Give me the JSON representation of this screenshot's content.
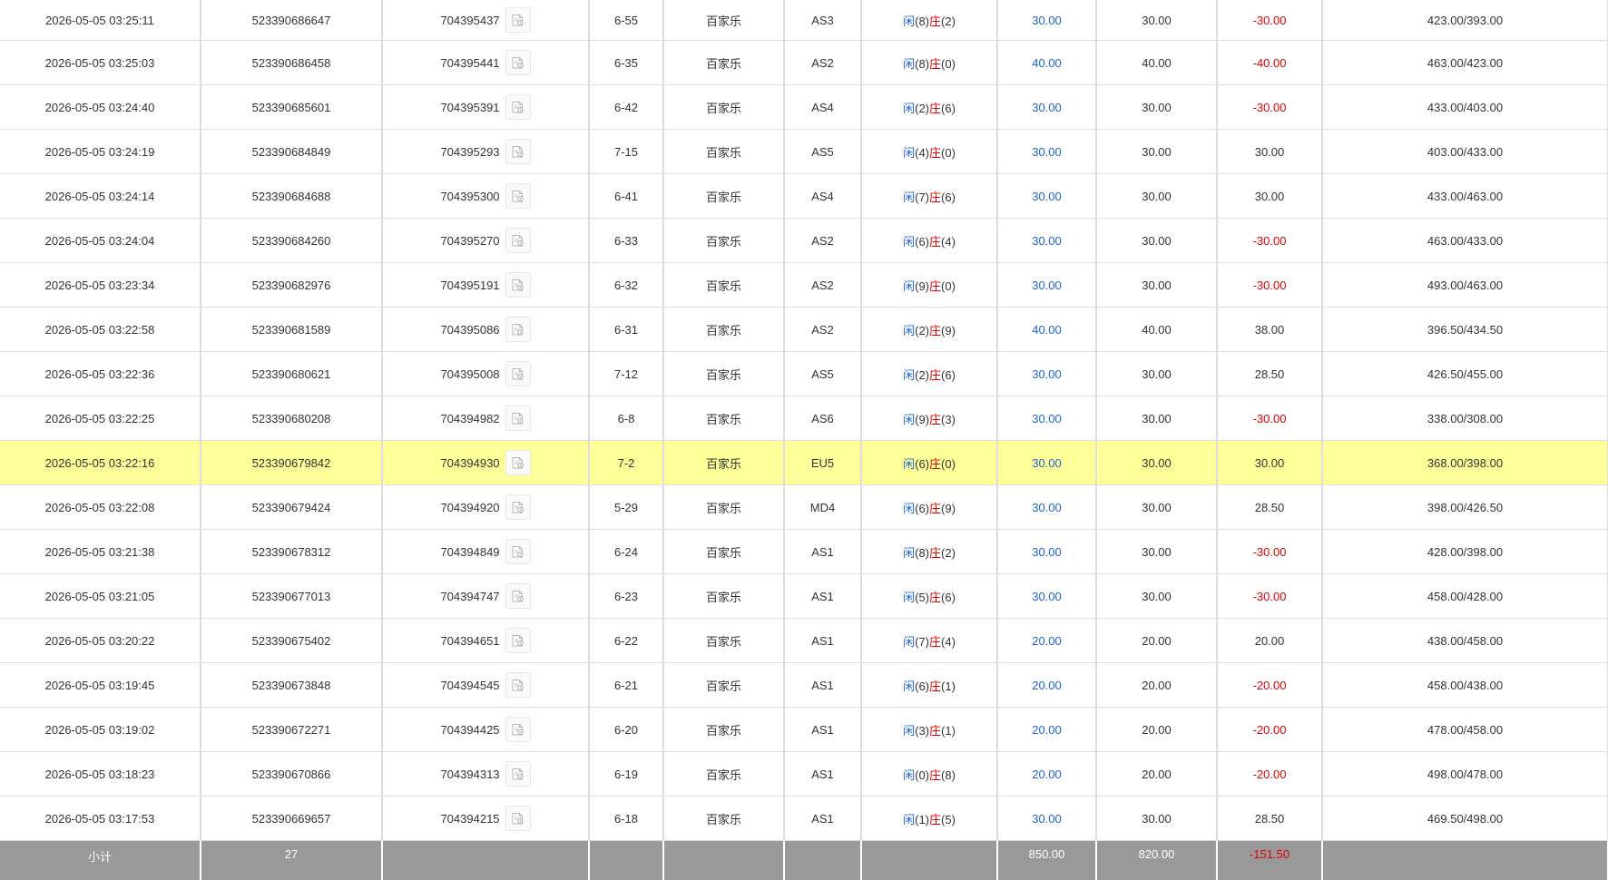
{
  "colors": {
    "win": "#1e64d6",
    "loss": "#e00000",
    "highlight": "#ffff99",
    "subtotal_bg": "#999999"
  },
  "icons": {
    "row_detail": "detail-document-icon"
  },
  "rows": [
    {
      "time": "2026-05-05 03:25:11",
      "bet_id": "523390686647",
      "game_id": "704395437",
      "round": "6-55",
      "game": "百家乐",
      "table": "AS3",
      "p_label": "闲",
      "p_score": "(8)",
      "b_label": "庄",
      "b_score": "(2)",
      "bet": "30.00",
      "valid": "30.00",
      "payout": "-30.00",
      "payout_neg": true,
      "balance": "423.00/393.00",
      "highlight": false
    },
    {
      "time": "2026-05-05 03:25:03",
      "bet_id": "523390686458",
      "game_id": "704395441",
      "round": "6-35",
      "game": "百家乐",
      "table": "AS2",
      "p_label": "闲",
      "p_score": "(8)",
      "b_label": "庄",
      "b_score": "(0)",
      "bet": "40.00",
      "valid": "40.00",
      "payout": "-40.00",
      "payout_neg": true,
      "balance": "463.00/423.00",
      "highlight": false
    },
    {
      "time": "2026-05-05 03:24:40",
      "bet_id": "523390685601",
      "game_id": "704395391",
      "round": "6-42",
      "game": "百家乐",
      "table": "AS4",
      "p_label": "闲",
      "p_score": "(2)",
      "b_label": "庄",
      "b_score": "(6)",
      "bet": "30.00",
      "valid": "30.00",
      "payout": "-30.00",
      "payout_neg": true,
      "balance": "433.00/403.00",
      "highlight": false
    },
    {
      "time": "2026-05-05 03:24:19",
      "bet_id": "523390684849",
      "game_id": "704395293",
      "round": "7-15",
      "game": "百家乐",
      "table": "AS5",
      "p_label": "闲",
      "p_score": "(4)",
      "b_label": "庄",
      "b_score": "(0)",
      "bet": "30.00",
      "valid": "30.00",
      "payout": "30.00",
      "payout_neg": false,
      "balance": "403.00/433.00",
      "highlight": false
    },
    {
      "time": "2026-05-05 03:24:14",
      "bet_id": "523390684688",
      "game_id": "704395300",
      "round": "6-41",
      "game": "百家乐",
      "table": "AS4",
      "p_label": "闲",
      "p_score": "(7)",
      "b_label": "庄",
      "b_score": "(6)",
      "bet": "30.00",
      "valid": "30.00",
      "payout": "30.00",
      "payout_neg": false,
      "balance": "433.00/463.00",
      "highlight": false
    },
    {
      "time": "2026-05-05 03:24:04",
      "bet_id": "523390684260",
      "game_id": "704395270",
      "round": "6-33",
      "game": "百家乐",
      "table": "AS2",
      "p_label": "闲",
      "p_score": "(6)",
      "b_label": "庄",
      "b_score": "(4)",
      "bet": "30.00",
      "valid": "30.00",
      "payout": "-30.00",
      "payout_neg": true,
      "balance": "463.00/433.00",
      "highlight": false
    },
    {
      "time": "2026-05-05 03:23:34",
      "bet_id": "523390682976",
      "game_id": "704395191",
      "round": "6-32",
      "game": "百家乐",
      "table": "AS2",
      "p_label": "闲",
      "p_score": "(9)",
      "b_label": "庄",
      "b_score": "(0)",
      "bet": "30.00",
      "valid": "30.00",
      "payout": "-30.00",
      "payout_neg": true,
      "balance": "493.00/463.00",
      "highlight": false
    },
    {
      "time": "2026-05-05 03:22:58",
      "bet_id": "523390681589",
      "game_id": "704395086",
      "round": "6-31",
      "game": "百家乐",
      "table": "AS2",
      "p_label": "闲",
      "p_score": "(2)",
      "b_label": "庄",
      "b_score": "(9)",
      "bet": "40.00",
      "valid": "40.00",
      "payout": "38.00",
      "payout_neg": false,
      "balance": "396.50/434.50",
      "highlight": false
    },
    {
      "time": "2026-05-05 03:22:36",
      "bet_id": "523390680621",
      "game_id": "704395008",
      "round": "7-12",
      "game": "百家乐",
      "table": "AS5",
      "p_label": "闲",
      "p_score": "(2)",
      "b_label": "庄",
      "b_score": "(6)",
      "bet": "30.00",
      "valid": "30.00",
      "payout": "28.50",
      "payout_neg": false,
      "balance": "426.50/455.00",
      "highlight": false
    },
    {
      "time": "2026-05-05 03:22:25",
      "bet_id": "523390680208",
      "game_id": "704394982",
      "round": "6-8",
      "game": "百家乐",
      "table": "AS6",
      "p_label": "闲",
      "p_score": "(9)",
      "b_label": "庄",
      "b_score": "(3)",
      "bet": "30.00",
      "valid": "30.00",
      "payout": "-30.00",
      "payout_neg": true,
      "balance": "338.00/308.00",
      "highlight": false
    },
    {
      "time": "2026-05-05 03:22:16",
      "bet_id": "523390679842",
      "game_id": "704394930",
      "round": "7-2",
      "game": "百家乐",
      "table": "EU5",
      "p_label": "闲",
      "p_score": "(6)",
      "b_label": "庄",
      "b_score": "(0)",
      "bet": "30.00",
      "valid": "30.00",
      "payout": "30.00",
      "payout_neg": false,
      "balance": "368.00/398.00",
      "highlight": true
    },
    {
      "time": "2026-05-05 03:22:08",
      "bet_id": "523390679424",
      "game_id": "704394920",
      "round": "5-29",
      "game": "百家乐",
      "table": "MD4",
      "p_label": "闲",
      "p_score": "(6)",
      "b_label": "庄",
      "b_score": "(9)",
      "bet": "30.00",
      "valid": "30.00",
      "payout": "28.50",
      "payout_neg": false,
      "balance": "398.00/426.50",
      "highlight": false
    },
    {
      "time": "2026-05-05 03:21:38",
      "bet_id": "523390678312",
      "game_id": "704394849",
      "round": "6-24",
      "game": "百家乐",
      "table": "AS1",
      "p_label": "闲",
      "p_score": "(8)",
      "b_label": "庄",
      "b_score": "(2)",
      "bet": "30.00",
      "valid": "30.00",
      "payout": "-30.00",
      "payout_neg": true,
      "balance": "428.00/398.00",
      "highlight": false
    },
    {
      "time": "2026-05-05 03:21:05",
      "bet_id": "523390677013",
      "game_id": "704394747",
      "round": "6-23",
      "game": "百家乐",
      "table": "AS1",
      "p_label": "闲",
      "p_score": "(5)",
      "b_label": "庄",
      "b_score": "(6)",
      "bet": "30.00",
      "valid": "30.00",
      "payout": "-30.00",
      "payout_neg": true,
      "balance": "458.00/428.00",
      "highlight": false
    },
    {
      "time": "2026-05-05 03:20:22",
      "bet_id": "523390675402",
      "game_id": "704394651",
      "round": "6-22",
      "game": "百家乐",
      "table": "AS1",
      "p_label": "闲",
      "p_score": "(7)",
      "b_label": "庄",
      "b_score": "(4)",
      "bet": "20.00",
      "valid": "20.00",
      "payout": "20.00",
      "payout_neg": false,
      "balance": "438.00/458.00",
      "highlight": false
    },
    {
      "time": "2026-05-05 03:19:45",
      "bet_id": "523390673848",
      "game_id": "704394545",
      "round": "6-21",
      "game": "百家乐",
      "table": "AS1",
      "p_label": "闲",
      "p_score": "(6)",
      "b_label": "庄",
      "b_score": "(1)",
      "bet": "20.00",
      "valid": "20.00",
      "payout": "-20.00",
      "payout_neg": true,
      "balance": "458.00/438.00",
      "highlight": false
    },
    {
      "time": "2026-05-05 03:19:02",
      "bet_id": "523390672271",
      "game_id": "704394425",
      "round": "6-20",
      "game": "百家乐",
      "table": "AS1",
      "p_label": "闲",
      "p_score": "(3)",
      "b_label": "庄",
      "b_score": "(1)",
      "bet": "20.00",
      "valid": "20.00",
      "payout": "-20.00",
      "payout_neg": true,
      "balance": "478.00/458.00",
      "highlight": false
    },
    {
      "time": "2026-05-05 03:18:23",
      "bet_id": "523390670866",
      "game_id": "704394313",
      "round": "6-19",
      "game": "百家乐",
      "table": "AS1",
      "p_label": "闲",
      "p_score": "(0)",
      "b_label": "庄",
      "b_score": "(8)",
      "bet": "20.00",
      "valid": "20.00",
      "payout": "-20.00",
      "payout_neg": true,
      "balance": "498.00/478.00",
      "highlight": false
    },
    {
      "time": "2026-05-05 03:17:53",
      "bet_id": "523390669657",
      "game_id": "704394215",
      "round": "6-18",
      "game": "百家乐",
      "table": "AS1",
      "p_label": "闲",
      "p_score": "(1)",
      "b_label": "庄",
      "b_score": "(5)",
      "bet": "30.00",
      "valid": "30.00",
      "payout": "28.50",
      "payout_neg": false,
      "balance": "469.50/498.00",
      "highlight": false
    }
  ],
  "subtotal": {
    "label": "小计",
    "count": "27",
    "bet": "850.00",
    "valid": "820.00",
    "payout": "-151.50",
    "payout_neg": true
  }
}
